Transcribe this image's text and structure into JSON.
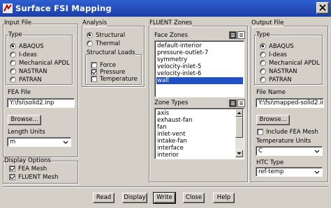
{
  "window": {
    "title": "Surface FSI Mapping"
  },
  "input_file": {
    "section_label": "Input File",
    "type_label": "Type",
    "type_options": [
      "ABAQUS",
      "I-deas",
      "Mechanical APDL",
      "NASTRAN",
      "PATRAN"
    ],
    "type_selected": "ABAQUS",
    "fea_file_label": "FEA File",
    "fea_file_value": "Y:\\fsi\\solid2.inp",
    "browse_label": "Browse...",
    "length_units_label": "Length Units",
    "length_units_value": "m"
  },
  "display_options": {
    "section_label": "Display Options",
    "items": [
      {
        "label": "FEA Mesh",
        "checked": true
      },
      {
        "label": "FLUENT Mesh",
        "checked": true
      }
    ]
  },
  "analysis": {
    "section_label": "Analysis",
    "options": [
      "Structural",
      "Thermal"
    ],
    "selected": "Structural",
    "loads_label": "Structural Loads",
    "loads": [
      {
        "label": "Force",
        "checked": false
      },
      {
        "label": "Pressure",
        "checked": true
      },
      {
        "label": "Temperature",
        "checked": false
      }
    ]
  },
  "fluent_zones": {
    "section_label": "FLUENT Zones",
    "face_zones_label": "Face Zones",
    "face_zones": [
      "default-interior",
      "pressure-outlet-7",
      "symmetry",
      "velocity-inlet-5",
      "velocity-inlet-6",
      "wall"
    ],
    "face_zones_selected": "wall",
    "cell_types_label": "Zone Types",
    "cell_types": [
      "axis",
      "exhaust-fan",
      "fan",
      "inlet-vent",
      "intake-fan",
      "interface",
      "interior"
    ]
  },
  "output_file": {
    "section_label": "Output File",
    "type_label": "Type",
    "type_options": [
      "ABAQUS",
      "I-deas",
      "Mechanical APDL",
      "NASTRAN",
      "PATRAN"
    ],
    "type_selected": "ABAQUS",
    "file_name_label": "File Name",
    "file_name_value": "Y:\\fsi\\mapped-solid2.ir",
    "browse_label": "Browse...",
    "include_fea_mesh_label": "Include FEA Mesh",
    "include_fea_mesh_checked": false,
    "temp_units_label": "Temperature Units",
    "temp_units_value": "C",
    "htc_type_label": "HTC Type",
    "htc_type_value": "ref-temp"
  },
  "buttons": {
    "read": "Read",
    "display": "Display",
    "write": "Write",
    "close": "Close",
    "help": "Help"
  },
  "colors": {
    "title_bar": "#1c3ea8",
    "selection": "#2050c8",
    "window_bg": "#d4d0c8"
  }
}
